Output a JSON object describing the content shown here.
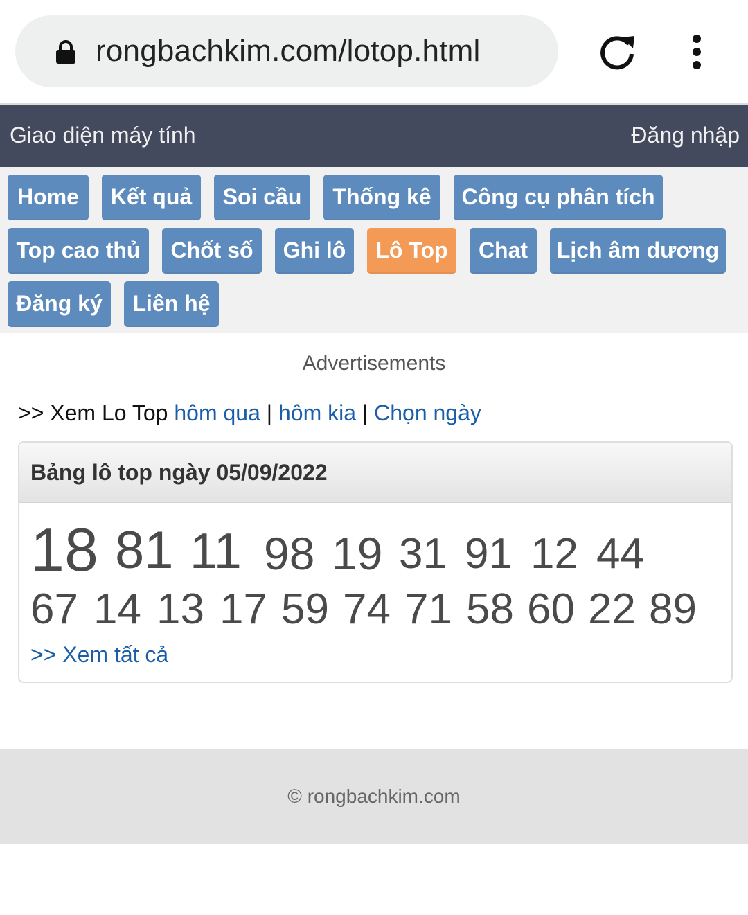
{
  "browser": {
    "url": "rongbachkim.com/lotop.html",
    "icons": [
      "lock-icon",
      "reload-icon",
      "more-vert-icon"
    ]
  },
  "topbar": {
    "left": "Giao diện máy tính",
    "right": "Đăng nhập"
  },
  "nav": {
    "items": [
      {
        "label": "Home"
      },
      {
        "label": "Kết quả"
      },
      {
        "label": "Soi cầu"
      },
      {
        "label": "Thống kê"
      },
      {
        "label": "Công cụ phân tích"
      },
      {
        "label": "Top cao thủ"
      },
      {
        "label": "Chốt số"
      },
      {
        "label": "Ghi lô"
      },
      {
        "label": "Lô Top",
        "active": true
      },
      {
        "label": "Chat"
      },
      {
        "label": "Lịch âm dương"
      },
      {
        "label": "Đăng ký"
      },
      {
        "label": "Liên hệ"
      }
    ],
    "colors": {
      "button": "#5e8bbd",
      "active": "#f29a56"
    }
  },
  "ads": "Advertisements",
  "links": {
    "prefix": ">> Xem Lo Top ",
    "yesterday": "hôm qua",
    "sep1": " | ",
    "day_before": "hôm kia",
    "sep2": " | ",
    "choose_date": "Chọn ngày"
  },
  "panel": {
    "title": "Bảng lô top ngày 05/09/2022",
    "numbers": [
      "18",
      "81",
      "11",
      "98",
      "19",
      "31",
      "91",
      "12",
      "44",
      "67",
      "14",
      "13",
      "17",
      "59",
      "74",
      "71",
      "58",
      "60",
      "22",
      "89"
    ],
    "see_all": ">> Xem tất cả"
  },
  "footer": "© rongbachkim.com"
}
